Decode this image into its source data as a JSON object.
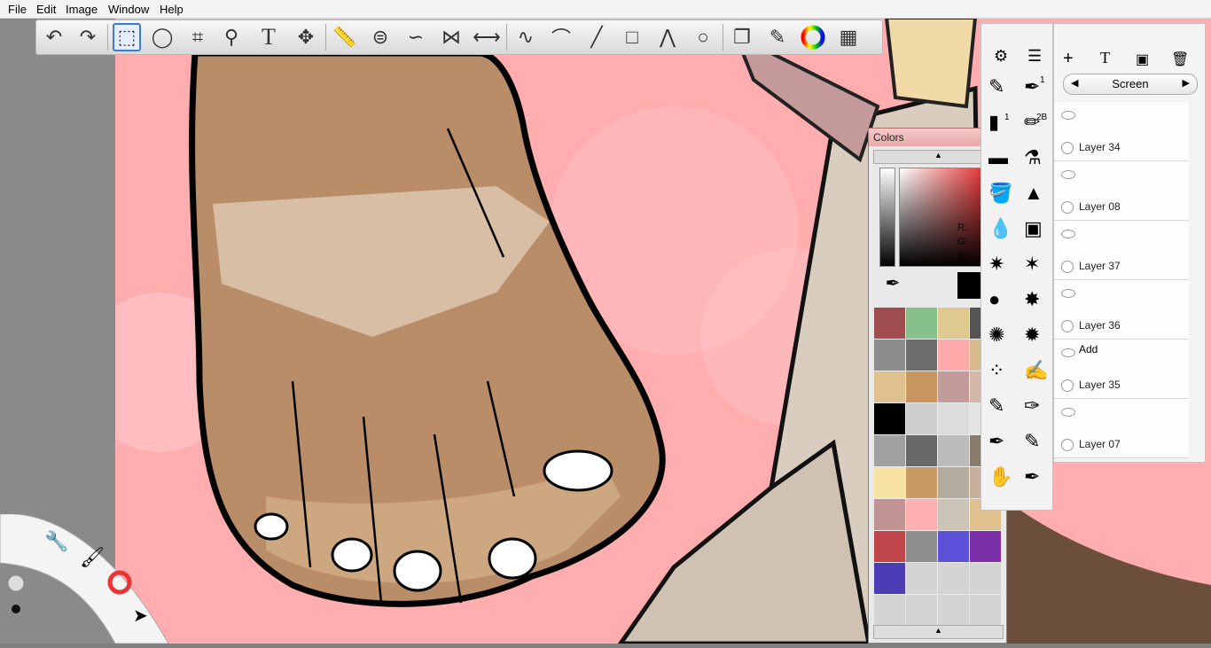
{
  "menu": [
    "File",
    "Edit",
    "Image",
    "Window",
    "Help"
  ],
  "toolbar": {
    "tools": [
      "undo-icon",
      "redo-icon",
      "select-rect-icon",
      "lasso-icon",
      "crop-icon",
      "zoom-icon",
      "text-icon",
      "move-icon",
      "ruler-icon",
      "ellipse-guide-icon",
      "french-curve-icon",
      "symmetry-icon",
      "symmetry-x-icon",
      "stroke-icon",
      "curve-icon",
      "line-icon",
      "rect-icon",
      "polyline-icon",
      "circle-icon",
      "layer-stack-icon",
      "brush-set-icon",
      "color-wheel-icon",
      "grid-icon"
    ],
    "text_label": "T"
  },
  "colors_panel": {
    "title": "Colors",
    "rgb_labels": [
      "R:",
      "G:",
      "B:"
    ],
    "swatches": [
      "#a04d4f",
      "#87c08a",
      "#e0c98e",
      "#555555",
      "#8c8c8c",
      "#6e6e6e",
      "#ffaaaa",
      "#d8bb8a",
      "#dfc190",
      "#c79660",
      "#c29b9b",
      "#d4b7a8",
      "#000000",
      "#cfcfcf",
      "#dcdcdc",
      "#e3e3e3",
      "#a0a0a0",
      "#696969",
      "#bcbcbc",
      "#8a7c6c",
      "#f9e3a2",
      "#c99a61",
      "#b4ab9f",
      "#c9b09c",
      "#c29393",
      "#ffb1b1",
      "#cdc4b8",
      "#e0c08d",
      "#c1464b",
      "#8e8e8e",
      "#5c51d8",
      "#7b2fa8",
      "#4b3eb5",
      "#d4d4d4",
      "#d4d4d4",
      "#d4d4d4",
      "#d4d4d4",
      "#d4d4d4",
      "#d4d4d4",
      "#d4d4d4"
    ]
  },
  "brush_panel": {
    "brush_badges": [
      "1",
      "1",
      "2B"
    ]
  },
  "layers_panel": {
    "blend_mode": "Screen",
    "blend_mode_label": "Add",
    "layers": [
      "Layer 34",
      "Layer 08",
      "Layer 37",
      "Layer 36",
      "Layer 35",
      "Layer 07"
    ]
  }
}
